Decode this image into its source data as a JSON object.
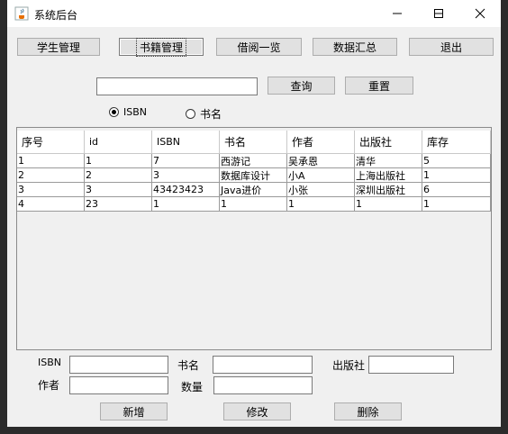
{
  "window": {
    "title": "系统后台"
  },
  "nav": {
    "student_mgmt": "学生管理",
    "book_mgmt": "书籍管理",
    "borrow_list": "借阅一览",
    "data_summary": "数据汇总",
    "exit": "退出"
  },
  "search": {
    "query_value": "",
    "query_button": "查询",
    "reset_button": "重置",
    "options": [
      {
        "label": "ISBN",
        "selected": true
      },
      {
        "label": "书名",
        "selected": false
      }
    ]
  },
  "table": {
    "columns": [
      "序号",
      "id",
      "ISBN",
      "书名",
      "作者",
      "出版社",
      "库存"
    ],
    "rows": [
      [
        "1",
        "1",
        "7",
        "西游记",
        "吴承恩",
        "清华",
        "5"
      ],
      [
        "2",
        "2",
        "3",
        "数据库设计",
        "小A",
        "上海出版社",
        "1"
      ],
      [
        "3",
        "3",
        "43423423",
        "Java进价",
        "小张",
        "深圳出版社",
        "6"
      ],
      [
        "4",
        "23",
        "1",
        "1",
        "1",
        "1",
        "1"
      ]
    ]
  },
  "form": {
    "isbn_label": "ISBN",
    "title_label": "书名",
    "publisher_label": "出版社",
    "author_label": "作者",
    "qty_label": "数量",
    "isbn_value": "",
    "title_value": "",
    "publisher_value": "",
    "author_value": "",
    "qty_value": "",
    "add_button": "新增",
    "edit_button": "修改",
    "delete_button": "删除"
  },
  "icons": {
    "app": "java-cup-icon",
    "minimize": "minimize-icon",
    "maximize": "maximize-icon",
    "close": "close-icon"
  }
}
